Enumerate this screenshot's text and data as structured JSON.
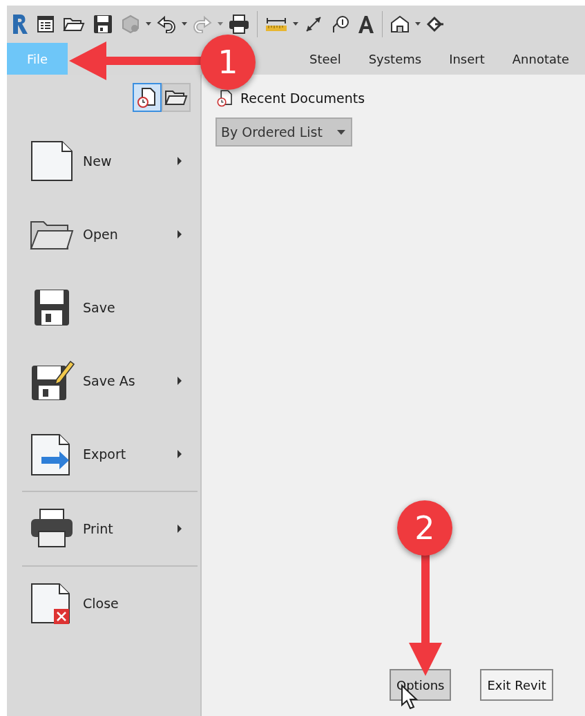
{
  "ribbon_tabs": [
    {
      "label": "File",
      "selected": true
    },
    {
      "label": "Steel",
      "selected": false
    },
    {
      "label": "Systems",
      "selected": false
    },
    {
      "label": "Insert",
      "selected": false
    },
    {
      "label": "Annotate",
      "selected": false
    }
  ],
  "view_toggle": [
    {
      "kind": "recent",
      "selected": true
    },
    {
      "kind": "open",
      "selected": false
    }
  ],
  "file_menu": [
    {
      "kind": "new",
      "label": "New",
      "submenu": true,
      "divider_before": false
    },
    {
      "kind": "open",
      "label": "Open",
      "submenu": true,
      "divider_before": false
    },
    {
      "kind": "save",
      "label": "Save",
      "submenu": false,
      "divider_before": false
    },
    {
      "kind": "saveas",
      "label": "Save As",
      "submenu": true,
      "divider_before": false
    },
    {
      "kind": "export",
      "label": "Export",
      "submenu": true,
      "divider_before": false
    },
    {
      "kind": "print",
      "label": "Print",
      "submenu": true,
      "divider_before": true
    },
    {
      "kind": "close",
      "label": "Close",
      "submenu": false,
      "divider_before": true
    }
  ],
  "recent": {
    "title": "Recent Documents",
    "sort": "By Ordered List"
  },
  "buttons": [
    {
      "label": "Options",
      "hovered": true
    },
    {
      "label": "Exit Revit",
      "hovered": false
    }
  ],
  "callouts": [
    {
      "label": "1",
      "kind": "left"
    },
    {
      "label": "2",
      "kind": "down"
    }
  ]
}
